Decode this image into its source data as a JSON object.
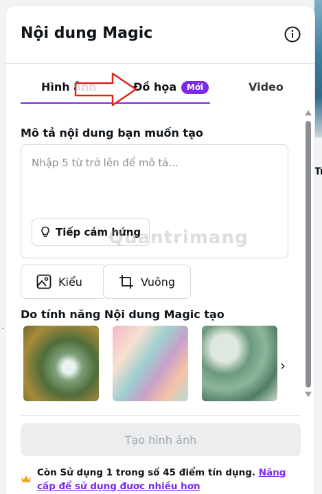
{
  "panel": {
    "title": "Nội dung Magic",
    "tabs": [
      {
        "label": "Hình ảnh"
      },
      {
        "label": "Đồ họa",
        "badge": "Mới"
      },
      {
        "label": "Video"
      }
    ]
  },
  "prompt": {
    "label": "Mô tả nội dung bạn muốn tạo",
    "placeholder": "Nhập 5 từ trở lên để mô tả...",
    "inspire_label": "Tiếp cảm hứng"
  },
  "options": {
    "style_label": "Kiểu",
    "ratio_label": "Vuông"
  },
  "examples": {
    "label": "Do tính năng Nội dung Magic tạo"
  },
  "actions": {
    "create_label": "Tạo hình ảnh"
  },
  "credits": {
    "text": "Còn Sử dụng 1 trong số 45 điểm tín dụng.",
    "link": "Nâng cấp để sử dụng được nhiều hơn"
  },
  "background": {
    "side_text": "Tr",
    "side_dots": "..."
  },
  "watermark": "Quantrimang",
  "colors": {
    "accent": "#7d2ae8",
    "arrow": "#e0221c"
  }
}
